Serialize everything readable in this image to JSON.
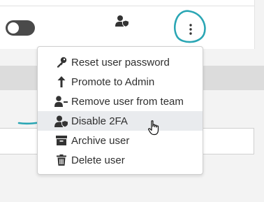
{
  "colors": {
    "annotation": "#2aa6b4",
    "menu_hover": "#e9ebee",
    "toggle_off": "#4a4a4a",
    "text": "#2f2f2f"
  },
  "header": {
    "toggle_state": "off",
    "column_icon": "user-shield-icon",
    "actions_icon": "vertical-ellipsis-icon"
  },
  "menu": {
    "items": [
      {
        "label": "Reset user password",
        "icon": "key-icon"
      },
      {
        "label": "Promote to Admin",
        "icon": "arrow-up-icon"
      },
      {
        "label": "Remove user from team",
        "icon": "user-minus-icon"
      },
      {
        "label": "Disable 2FA",
        "icon": "user-shield-icon",
        "hovered": true
      },
      {
        "label": "Archive user",
        "icon": "archive-icon"
      },
      {
        "label": "Delete user",
        "icon": "trash-icon"
      }
    ]
  }
}
